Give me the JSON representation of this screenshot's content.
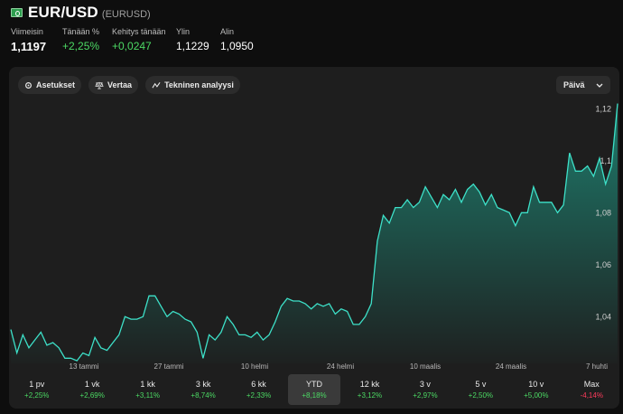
{
  "header": {
    "title": "EUR/USD",
    "symbol": "(EURUSD)",
    "icon": "currency-note-icon"
  },
  "stats": [
    {
      "label": "Viimeisin",
      "value": "1,1197"
    },
    {
      "label": "Tänään %",
      "value": "+2,25%"
    },
    {
      "label": "Kehitys tänään",
      "value": "+0,0247"
    },
    {
      "label": "Ylin",
      "value": "1,1229"
    },
    {
      "label": "Alin",
      "value": "1,0950"
    }
  ],
  "toolbar": {
    "settings_label": "Asetukset",
    "compare_label": "Vertaa",
    "technical_label": "Tekninen analyysi",
    "interval_value": "Päivä"
  },
  "colors": {
    "line": "#3de0c8",
    "positive": "#4cd964",
    "negative": "#ff3b5c"
  },
  "chart_data": {
    "type": "area",
    "x_ticks": [
      "13 tammi",
      "27 tammi",
      "10 helmi",
      "24 helmi",
      "10 maalis",
      "24 maalis",
      "7 huhti"
    ],
    "y_ticks": [
      "1,04",
      "1,06",
      "1,08",
      "1,1",
      "1,12"
    ],
    "ylim": [
      1.022,
      1.125
    ],
    "series": [
      {
        "values": [
          1.035,
          1.026,
          1.033,
          1.028,
          1.031,
          1.034,
          1.029,
          1.03,
          1.028,
          1.024,
          1.024,
          1.023,
          1.026,
          1.025,
          1.032,
          1.028,
          1.027,
          1.03,
          1.033,
          1.04,
          1.039,
          1.039,
          1.04,
          1.048,
          1.048,
          1.044,
          1.04,
          1.042,
          1.041,
          1.039,
          1.038,
          1.034,
          1.024,
          1.033,
          1.031,
          1.034,
          1.04,
          1.037,
          1.033,
          1.033,
          1.032,
          1.034,
          1.031,
          1.033,
          1.038,
          1.044,
          1.047,
          1.046,
          1.046,
          1.045,
          1.043,
          1.045,
          1.044,
          1.045,
          1.041,
          1.043,
          1.042,
          1.037,
          1.037,
          1.04,
          1.045,
          1.069,
          1.079,
          1.076,
          1.082,
          1.082,
          1.085,
          1.082,
          1.084,
          1.09,
          1.086,
          1.082,
          1.087,
          1.085,
          1.089,
          1.084,
          1.089,
          1.091,
          1.088,
          1.083,
          1.087,
          1.082,
          1.081,
          1.08,
          1.075,
          1.08,
          1.08,
          1.09,
          1.084,
          1.084,
          1.084,
          1.08,
          1.083,
          1.103,
          1.096,
          1.096,
          1.098,
          1.094,
          1.101,
          1.091,
          1.098,
          1.122
        ]
      }
    ]
  },
  "ranges": [
    {
      "label": "1 pv",
      "change": "+2,25%"
    },
    {
      "label": "1 vk",
      "change": "+2,69%"
    },
    {
      "label": "1 kk",
      "change": "+3,11%"
    },
    {
      "label": "3 kk",
      "change": "+8,74%"
    },
    {
      "label": "6 kk",
      "change": "+2,33%"
    },
    {
      "label": "YTD",
      "change": "+8,18%",
      "active": true
    },
    {
      "label": "12 kk",
      "change": "+3,12%"
    },
    {
      "label": "3 v",
      "change": "+2,97%"
    },
    {
      "label": "5 v",
      "change": "+2,50%"
    },
    {
      "label": "10 v",
      "change": "+5,00%"
    },
    {
      "label": "Max",
      "change": "-4,14%",
      "negative": true
    }
  ]
}
